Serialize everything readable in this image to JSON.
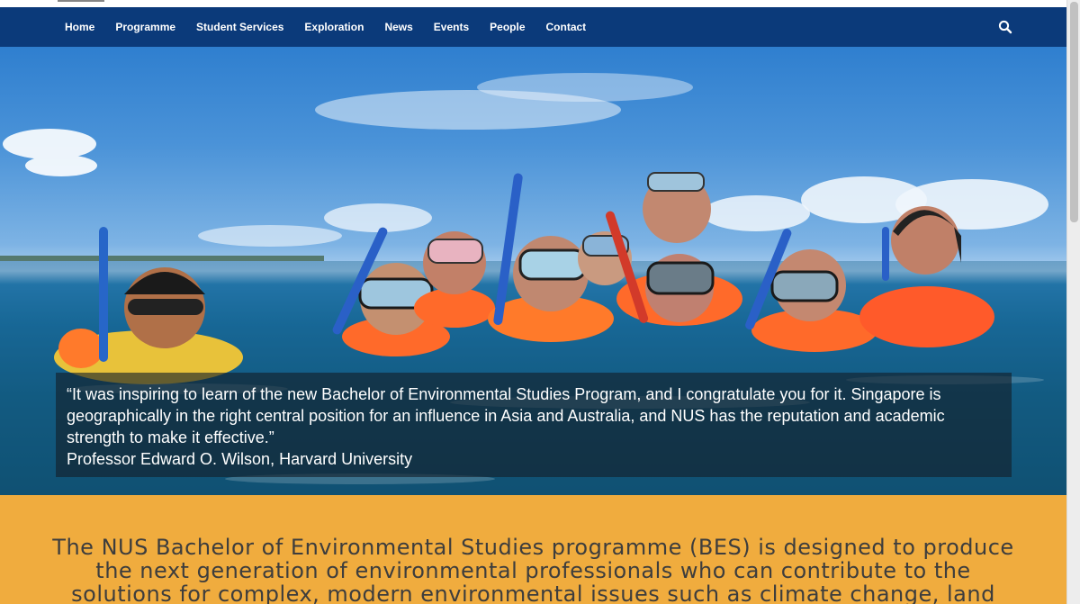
{
  "nav": {
    "items": [
      {
        "label": "Home"
      },
      {
        "label": "Programme"
      },
      {
        "label": "Student Services"
      },
      {
        "label": "Exploration"
      },
      {
        "label": "News"
      },
      {
        "label": "Events"
      },
      {
        "label": "People"
      },
      {
        "label": "Contact"
      }
    ],
    "search_icon": "search-icon"
  },
  "hero": {
    "image": "group-of-snorkelers-in-sea",
    "quote": "“It was inspiring to learn of the new Bachelor of Environmental Studies Program, and I congratulate you for it. Singapore is geographically in the right central position for an influence in Asia and Australia, and NUS has the reputation and academic strength to make it effective.”",
    "author": "Professor Edward O. Wilson, Harvard University"
  },
  "intro": {
    "text": "The NUS Bachelor of Environmental Studies programme (BES) is designed to produce the next generation of environmental professionals who can contribute to the solutions for complex, modern environmental issues such as climate change, land"
  },
  "colors": {
    "nav_bg": "#0b3a7a",
    "intro_bg": "#f0ac3e",
    "intro_text": "#3d3d3d"
  }
}
